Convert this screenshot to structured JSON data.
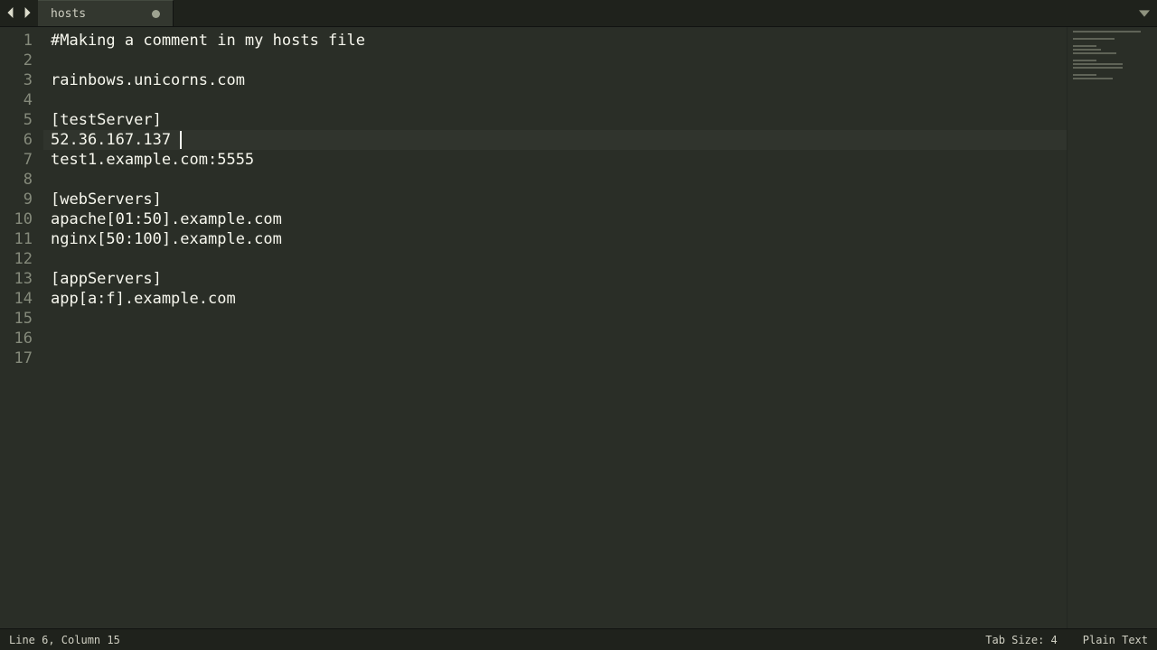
{
  "tab": {
    "title": "hosts",
    "dirty": true
  },
  "cursor": {
    "line": 6,
    "column": 15
  },
  "lines": [
    "#Making a comment in my hosts file",
    "",
    "rainbows.unicorns.com",
    "",
    "[testServer]",
    "52.36.167.137 ",
    "test1.example.com:5555",
    "",
    "[webServers]",
    "apache[01:50].example.com",
    "nginx[50:100].example.com",
    "",
    "[appServers]",
    "app[a:f].example.com",
    "",
    "",
    ""
  ],
  "statusbar": {
    "position_prefix": "Line ",
    "position_mid": ", Column ",
    "tab_size_label": "Tab Size: 4",
    "syntax_label": "Plain Text"
  }
}
